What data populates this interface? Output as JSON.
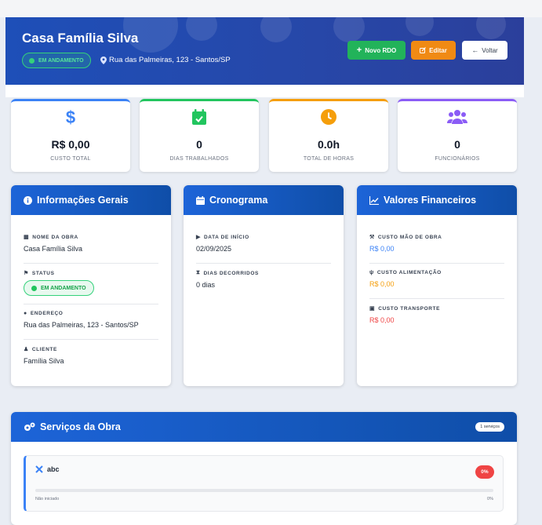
{
  "header": {
    "title": "Casa Família Silva",
    "status": "EM ANDAMENTO",
    "address": "Rua das Palmeiras, 123 - Santos/SP",
    "buttons": {
      "new_rdo": "Novo RDO",
      "edit": "Editar",
      "back": "Voltar"
    }
  },
  "stats": [
    {
      "icon": "dollar-icon",
      "value": "R$ 0,00",
      "label": "CUSTO TOTAL",
      "color": "#3b82f6"
    },
    {
      "icon": "calendar-check-icon",
      "value": "0",
      "label": "DIAS TRABALHADOS",
      "color": "#22c55e"
    },
    {
      "icon": "clock-icon",
      "value": "0.0h",
      "label": "TOTAL DE HORAS",
      "color": "#f59e0b"
    },
    {
      "icon": "users-icon",
      "value": "0",
      "label": "FUNCIONÁRIOS",
      "color": "#8b5cf6"
    }
  ],
  "info": {
    "title": "Informações Gerais",
    "name_label": "NOME DA OBRA",
    "name_value": "Casa Família Silva",
    "status_label": "STATUS",
    "status_value": "EM ANDAMENTO",
    "address_label": "ENDEREÇO",
    "address_value": "Rua das Palmeiras, 123 - Santos/SP",
    "client_label": "CLIENTE",
    "client_value": "Família Silva"
  },
  "schedule": {
    "title": "Cronograma",
    "start_label": "DATA DE INÍCIO",
    "start_value": "02/09/2025",
    "elapsed_label": "DIAS DECORRIDOS",
    "elapsed_value": "0 dias"
  },
  "finance": {
    "title": "Valores Financeiros",
    "labor_label": "CUSTO MÃO DE OBRA",
    "labor_value": "R$ 0,00",
    "food_label": "CUSTO ALIMENTAÇÃO",
    "food_value": "R$ 0,00",
    "transport_label": "CUSTO TRANSPORTE",
    "transport_value": "R$ 0,00"
  },
  "services": {
    "title": "Serviços da Obra",
    "count": "1 serviços",
    "items": [
      {
        "name": "abc",
        "percent_badge": "0%",
        "status": "Não iniciado",
        "percent": "0%",
        "progress": 0
      }
    ]
  },
  "colors": {
    "primary": "#1d64d8",
    "success": "#22c55e",
    "warning": "#f08a14",
    "danger": "#ef4444",
    "purple": "#8b5cf6"
  }
}
